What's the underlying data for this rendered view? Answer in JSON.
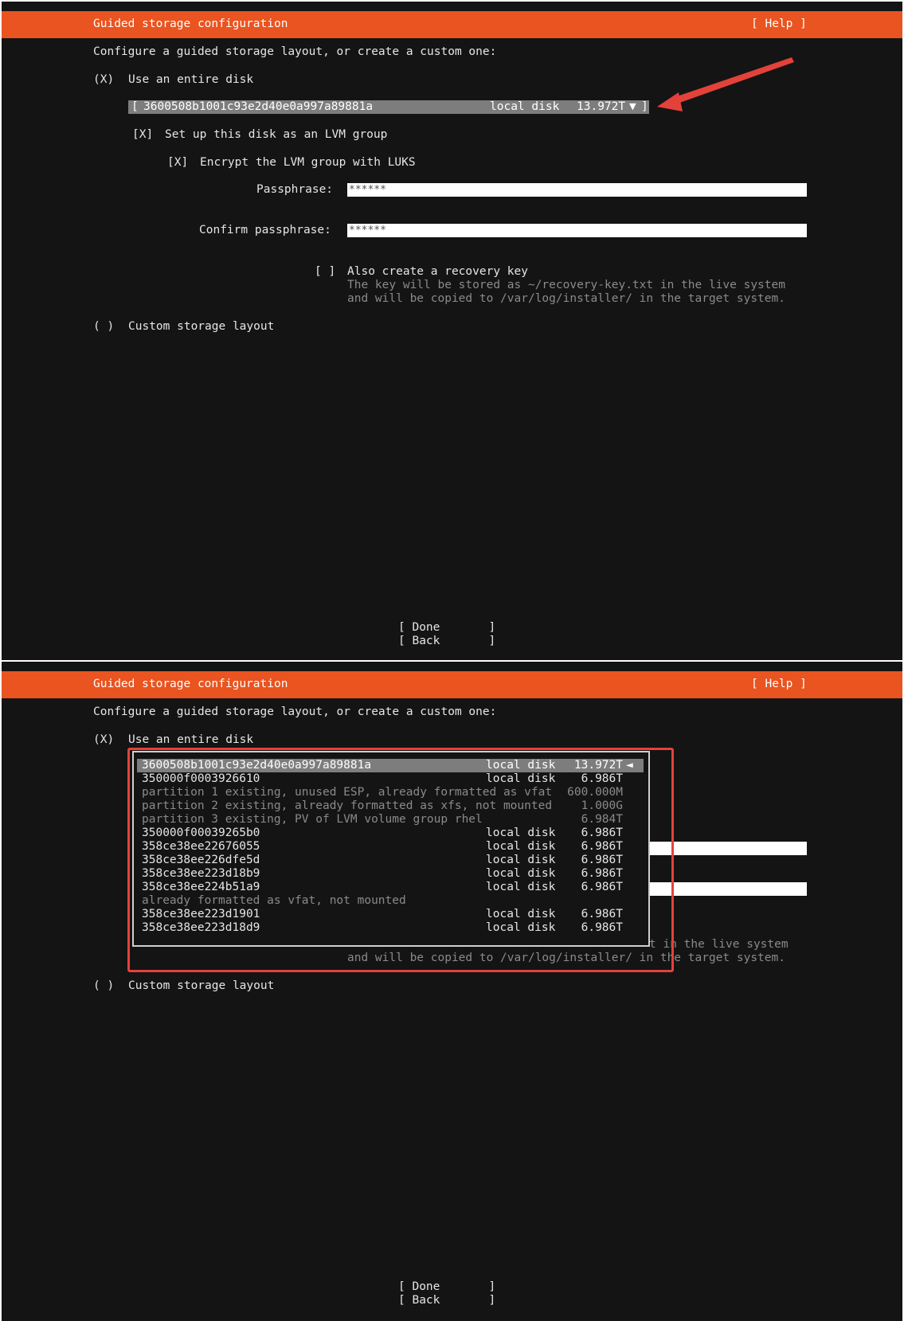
{
  "accent_color": "#e95420",
  "screens": [
    {
      "header": {
        "title": "Guided storage configuration",
        "help": "[ Help ]"
      },
      "intro": "Configure a guided storage layout, or create a custom one:",
      "use_entire_disk": {
        "mark": "(X)",
        "label": "Use an entire disk"
      },
      "disk_selector": {
        "open": "[",
        "name": "3600508b1001c93e2d40e0a997a89881a",
        "type": "local disk",
        "size": "13.972T",
        "arrow": "▼",
        "close": "]"
      },
      "lvm": {
        "mark": "[X]",
        "label": "Set up this disk as an LVM group"
      },
      "luks": {
        "mark": "[X]",
        "label": "Encrypt the LVM group with LUKS"
      },
      "passphrase": {
        "label": "Passphrase:",
        "value": "******"
      },
      "confirm_passphrase": {
        "label": "Confirm passphrase:",
        "value": "******"
      },
      "recovery_key": {
        "mark": "[ ]",
        "label": "Also create a recovery key",
        "desc_line1": "The key will be stored as ~/recovery-key.txt in the live system",
        "desc_line2": "and will be copied to /var/log/installer/ in the target system."
      },
      "custom_layout": {
        "mark": "( )",
        "label": "Custom storage layout"
      },
      "buttons": {
        "done": "[ Done       ]",
        "back": "[ Back       ]"
      }
    },
    {
      "header": {
        "title": "Guided storage configuration",
        "help": "[ Help ]"
      },
      "intro": "Configure a guided storage layout, or create a custom one:",
      "use_entire_disk": {
        "mark": "(X)",
        "label": "Use an entire disk"
      },
      "dropdown": {
        "selected_arrow": "◄",
        "rows": [
          {
            "name": "3600508b1001c93e2d40e0a997a89881a",
            "type": "local disk",
            "size": "13.972T",
            "selected": true
          },
          {
            "name": "350000f0003926610",
            "type": "local disk",
            "size": "6.986T"
          },
          {
            "name": "partition 1 existing, unused ESP, already formatted as vfat",
            "type": "",
            "size": "600.000M",
            "dim": true
          },
          {
            "name": "partition 2 existing, already formatted as xfs, not mounted",
            "type": "",
            "size": "1.000G",
            "dim": true
          },
          {
            "name": "partition 3 existing, PV of LVM volume group rhel",
            "type": "",
            "size": "6.984T",
            "dim": true
          },
          {
            "name": "350000f00039265b0",
            "type": "local disk",
            "size": "6.986T"
          },
          {
            "name": "358ce38ee22676055",
            "type": "local disk",
            "size": "6.986T"
          },
          {
            "name": "358ce38ee226dfe5d",
            "type": "local disk",
            "size": "6.986T"
          },
          {
            "name": "358ce38ee223d18b9",
            "type": "local disk",
            "size": "6.986T"
          },
          {
            "name": "358ce38ee224b51a9",
            "type": "local disk",
            "size": "6.986T"
          },
          {
            "name": "already formatted as vfat, not mounted",
            "type": "",
            "size": "",
            "dim": true
          },
          {
            "name": "358ce38ee223d1901",
            "type": "local disk",
            "size": "6.986T"
          },
          {
            "name": "358ce38ee223d18d9",
            "type": "local disk",
            "size": "6.986T"
          }
        ]
      },
      "behind_text_1": "t in the live system",
      "behind_text_2": "and will be copied to /var/log/installer/ in the target system.",
      "custom_layout": {
        "mark": "( )",
        "label": "Custom storage layout"
      },
      "buttons": {
        "done": "[ Done       ]",
        "back": "[ Back       ]"
      }
    }
  ]
}
